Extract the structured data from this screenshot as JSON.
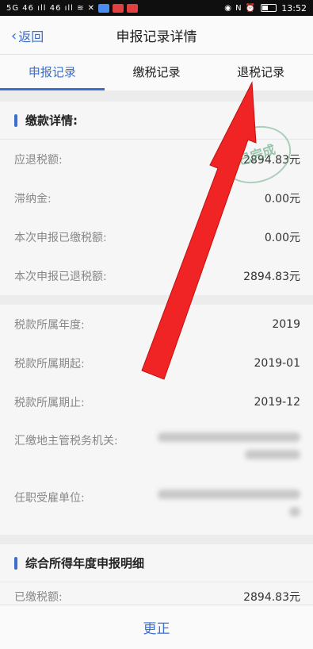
{
  "status_bar": {
    "left_glyphs": "5G 46 ıll 46 ıll ≋ ✕",
    "right_glyphs": "◉ N ⏰",
    "time": "13:52"
  },
  "nav": {
    "back_label": "返回",
    "title": "申报记录详情"
  },
  "tabs": [
    {
      "label": "申报记录"
    },
    {
      "label": "缴税记录"
    },
    {
      "label": "退税记录"
    }
  ],
  "payment_section": {
    "title": "缴款详情:",
    "stamp_text": "已完成",
    "rows": [
      {
        "label": "应退税额:",
        "value": "2894.83元"
      },
      {
        "label": "滞纳金:",
        "value": "0.00元"
      },
      {
        "label": "本次申报已缴税额:",
        "value": "0.00元"
      },
      {
        "label": "本次申报已退税额:",
        "value": "2894.83元"
      }
    ]
  },
  "period_section": {
    "rows": [
      {
        "label": "税款所属年度:",
        "value": "2019"
      },
      {
        "label": "税款所属期起:",
        "value": "2019-01"
      },
      {
        "label": "税款所属期止:",
        "value": "2019-12"
      },
      {
        "label": "汇缴地主管税务机关:"
      },
      {
        "label": "任职受雇单位:"
      }
    ]
  },
  "annual_section": {
    "title": "综合所得年度申报明细",
    "rows": [
      {
        "label": "已缴税额:",
        "value": "2894.83元"
      }
    ]
  },
  "bottom": {
    "correct_label": "更正"
  },
  "colors": {
    "accent": "#3a6fd0",
    "arrow": "#f02424",
    "stamp": "#4c9a6e"
  }
}
